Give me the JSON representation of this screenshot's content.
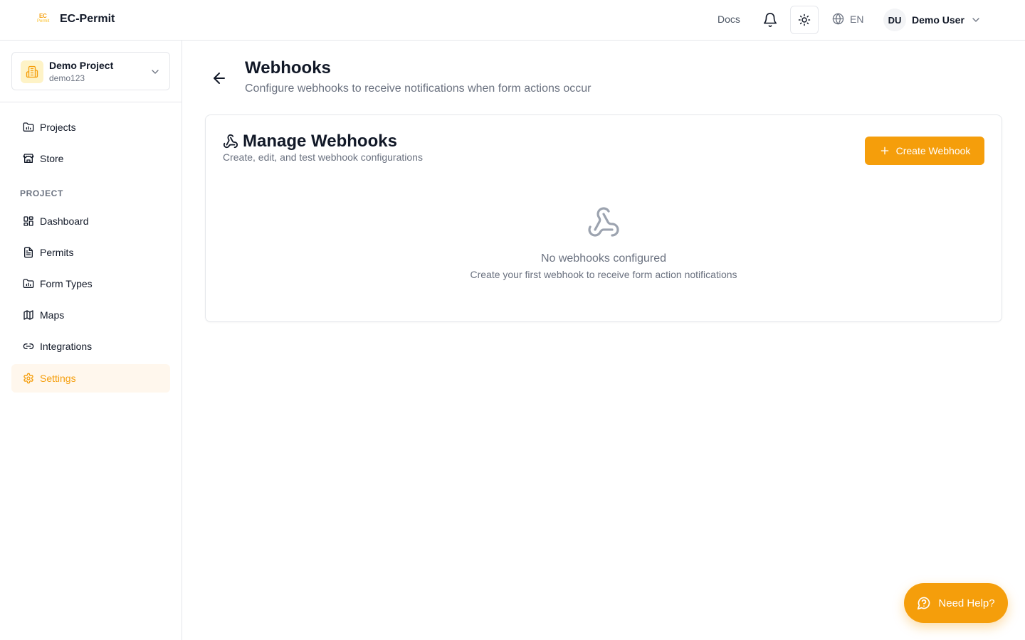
{
  "app": {
    "logo_line1": "EC",
    "logo_line2": "Permit",
    "name": "EC-Permit"
  },
  "header": {
    "docs_label": "Docs",
    "language": "EN",
    "user_initials": "DU",
    "user_name": "Demo User"
  },
  "sidebar": {
    "project": {
      "name": "Demo Project",
      "id": "demo123"
    },
    "top_items": [
      {
        "label": "Projects",
        "icon": "folder-chart-icon"
      },
      {
        "label": "Store",
        "icon": "store-icon"
      }
    ],
    "section_label": "PROJECT",
    "project_items": [
      {
        "label": "Dashboard",
        "icon": "dashboard-icon"
      },
      {
        "label": "Permits",
        "icon": "file-text-icon"
      },
      {
        "label": "Form Types",
        "icon": "folder-chart-icon"
      },
      {
        "label": "Maps",
        "icon": "map-icon"
      },
      {
        "label": "Integrations",
        "icon": "link-icon"
      },
      {
        "label": "Settings",
        "icon": "gear-icon",
        "active": true
      }
    ]
  },
  "page": {
    "title": "Webhooks",
    "subtitle": "Configure webhooks to receive notifications when form actions occur"
  },
  "card": {
    "title": "Manage Webhooks",
    "subtitle": "Create, edit, and test webhook configurations",
    "create_label": "Create Webhook",
    "empty_title": "No webhooks configured",
    "empty_subtitle": "Create your first webhook to receive form action notifications"
  },
  "help": {
    "label": "Need Help?"
  },
  "colors": {
    "accent": "#f59e0b",
    "active_bg": "#fff7ed",
    "border": "#e5e7eb",
    "muted_text": "#6b7280"
  }
}
